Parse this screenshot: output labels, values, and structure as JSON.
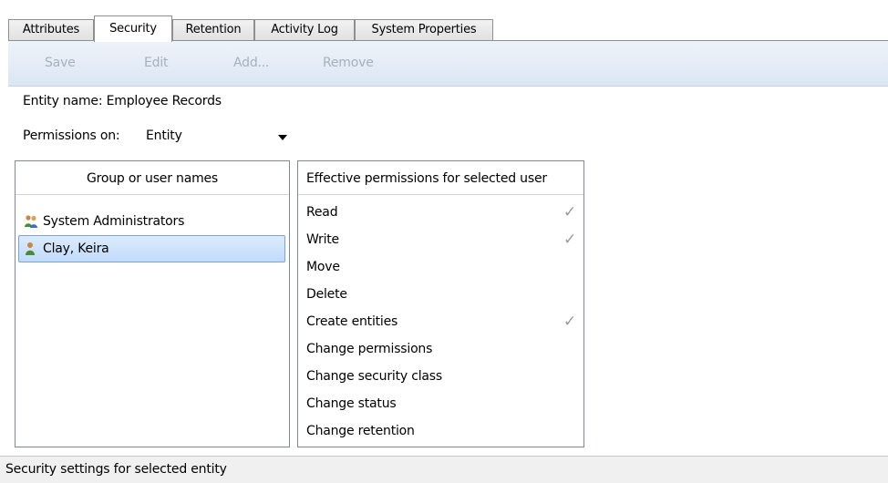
{
  "tabs": [
    {
      "label": "Attributes",
      "active": false
    },
    {
      "label": "Security",
      "active": true
    },
    {
      "label": "Retention",
      "active": false
    },
    {
      "label": "Activity Log",
      "active": false
    },
    {
      "label": "System Properties",
      "active": false
    }
  ],
  "toolbar": {
    "save_label": "Save",
    "edit_label": "Edit",
    "add_label": "Add...",
    "remove_label": "Remove"
  },
  "entity": {
    "label": "Entity name:",
    "name": "Employee Records"
  },
  "permissions_on": {
    "label": "Permissions on:",
    "value": "Entity"
  },
  "users_panel": {
    "header": "Group or user names",
    "items": [
      {
        "name": "System Administrators",
        "icon": "group-icon",
        "selected": false
      },
      {
        "name": "Clay, Keira",
        "icon": "user-icon",
        "selected": true
      }
    ]
  },
  "permissions_panel": {
    "header": "Effective permissions for selected user",
    "check_glyph": "✓",
    "items": [
      {
        "name": "Read",
        "granted": true
      },
      {
        "name": "Write",
        "granted": true
      },
      {
        "name": "Move",
        "granted": false
      },
      {
        "name": "Delete",
        "granted": false
      },
      {
        "name": "Create entities",
        "granted": true
      },
      {
        "name": "Change permissions",
        "granted": false
      },
      {
        "name": "Change security class",
        "granted": false
      },
      {
        "name": "Change status",
        "granted": false
      },
      {
        "name": "Change retention",
        "granted": false
      }
    ]
  },
  "status_bar": {
    "text": "Security settings for selected entity"
  },
  "colors": {
    "selection_bg": "#cce0fb",
    "selection_border": "#7da2ce",
    "toolbar_bg": "#dfe9f5",
    "disabled_text": "#a8b0bb",
    "check": "#9a9a9a"
  }
}
